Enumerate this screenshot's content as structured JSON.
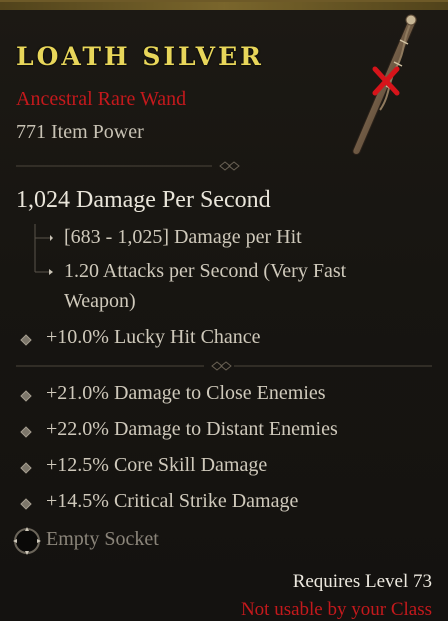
{
  "item": {
    "name": "LOATH SILVER",
    "type": "Ancestral Rare Wand",
    "item_power": "771 Item Power",
    "dps": "1,024 Damage Per Second",
    "damage_per_hit": "[683 - 1,025] Damage per Hit",
    "attacks_per_second_line1": "1.20 Attacks per Second (Very Fast",
    "attacks_per_second_line2": "Weapon)",
    "implicit": "+10.0% Lucky Hit Chance",
    "affixes": [
      "+21.0% Damage to Close Enemies",
      "+22.0% Damage to Distant Enemies",
      "+12.5% Core Skill Damage",
      "+14.5% Critical Strike Damage"
    ],
    "socket": "Empty Socket",
    "requires_level": "Requires Level 73",
    "class_warning": "Not usable by your Class"
  },
  "icons": {
    "wand": "wand-icon",
    "not_usable_mark": "red-x-icon",
    "socket": "empty-socket-icon",
    "bullet": "diamond-bullet-icon"
  },
  "colors": {
    "rare_title": "#e8d65a",
    "warning_red": "#c4191c",
    "text": "#cfc9bb"
  }
}
